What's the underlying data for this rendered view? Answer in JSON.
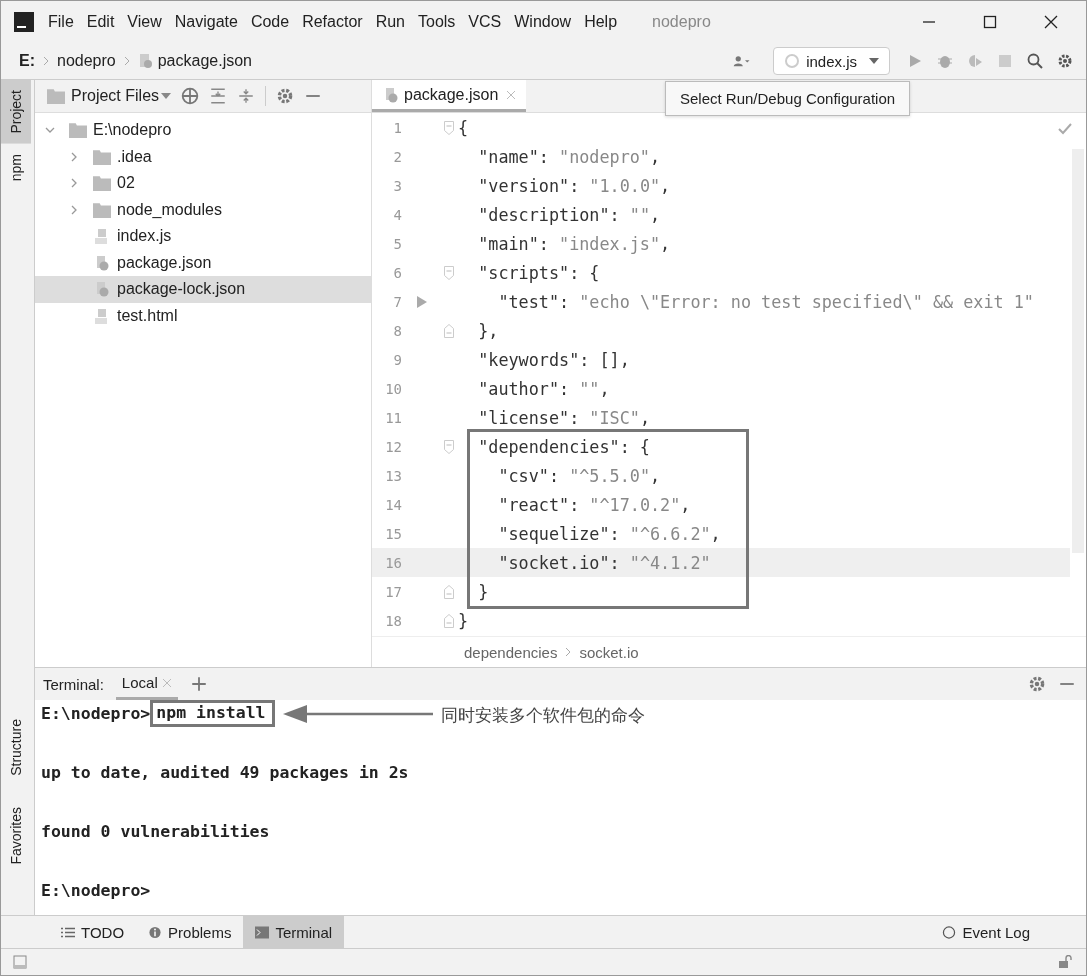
{
  "menu_bar": {
    "items": [
      "File",
      "Edit",
      "View",
      "Navigate",
      "Code",
      "Refactor",
      "Run",
      "Tools",
      "VCS",
      "Window",
      "Help"
    ],
    "title": "nodepro"
  },
  "nav_bar": {
    "breadcrumbs": [
      "E:",
      "nodepro",
      "package.json"
    ],
    "run_config": "index.js",
    "tooltip": "Select Run/Debug Configuration"
  },
  "left_stripe": {
    "top": [
      {
        "label": "Project",
        "selected": true
      },
      {
        "label": "npm",
        "selected": false
      }
    ],
    "bottom": [
      {
        "label": "Structure",
        "selected": false
      },
      {
        "label": "Favorites",
        "selected": false
      }
    ]
  },
  "project": {
    "view": "Project Files",
    "tree": [
      {
        "label": "E:\\nodepro",
        "kind": "folder",
        "expanded": true,
        "selected": false,
        "children": [
          {
            "label": ".idea",
            "kind": "folder",
            "expanded": false,
            "selected": false
          },
          {
            "label": "02",
            "kind": "folder",
            "expanded": false,
            "selected": false
          },
          {
            "label": "node_modules",
            "kind": "folder",
            "expanded": false,
            "selected": false
          },
          {
            "label": "index.js",
            "kind": "js",
            "selected": false
          },
          {
            "label": "package.json",
            "kind": "json",
            "selected": false
          },
          {
            "label": "package-lock.json",
            "kind": "json",
            "selected": true
          },
          {
            "label": "test.html",
            "kind": "html",
            "selected": false
          }
        ]
      }
    ]
  },
  "editor": {
    "tabs": [
      {
        "label": "package.json",
        "selected": true
      }
    ],
    "lines": [
      {
        "no": "1",
        "current": false,
        "kind": "fold-open",
        "segments": [
          {
            "kind": "punct",
            "text": "{"
          }
        ]
      },
      {
        "no": "2",
        "current": false,
        "kind": "plain",
        "segments": [
          {
            "kind": "key",
            "text": "  \"name\""
          },
          {
            "kind": "punct",
            "text": ": "
          },
          {
            "kind": "str",
            "text": "\"nodepro\""
          },
          {
            "kind": "punct",
            "text": ","
          }
        ]
      },
      {
        "no": "3",
        "current": false,
        "kind": "plain",
        "segments": [
          {
            "kind": "key",
            "text": "  \"version\""
          },
          {
            "kind": "punct",
            "text": ": "
          },
          {
            "kind": "str",
            "text": "\"1.0.0\""
          },
          {
            "kind": "punct",
            "text": ","
          }
        ]
      },
      {
        "no": "4",
        "current": false,
        "kind": "plain",
        "segments": [
          {
            "kind": "key",
            "text": "  \"description\""
          },
          {
            "kind": "punct",
            "text": ": "
          },
          {
            "kind": "str",
            "text": "\"\""
          },
          {
            "kind": "punct",
            "text": ","
          }
        ]
      },
      {
        "no": "5",
        "current": false,
        "kind": "plain",
        "segments": [
          {
            "kind": "key",
            "text": "  \"main\""
          },
          {
            "kind": "punct",
            "text": ": "
          },
          {
            "kind": "str",
            "text": "\"index.js\""
          },
          {
            "kind": "punct",
            "text": ","
          }
        ]
      },
      {
        "no": "6",
        "current": false,
        "kind": "fold-open",
        "segments": [
          {
            "kind": "key",
            "text": "  \"scripts\""
          },
          {
            "kind": "punct",
            "text": ": {"
          }
        ]
      },
      {
        "no": "7",
        "current": false,
        "kind": "run",
        "segments": [
          {
            "kind": "key",
            "text": "    \"test\""
          },
          {
            "kind": "punct",
            "text": ": "
          },
          {
            "kind": "str",
            "text": "\"echo \\\"Error: no test specified\\\" && exit 1\""
          }
        ]
      },
      {
        "no": "8",
        "current": false,
        "kind": "fold-close",
        "segments": [
          {
            "kind": "punct",
            "text": "  },"
          }
        ]
      },
      {
        "no": "9",
        "current": false,
        "kind": "plain",
        "segments": [
          {
            "kind": "key",
            "text": "  \"keywords\""
          },
          {
            "kind": "punct",
            "text": ": [],"
          }
        ]
      },
      {
        "no": "10",
        "current": false,
        "kind": "plain",
        "segments": [
          {
            "kind": "key",
            "text": "  \"author\""
          },
          {
            "kind": "punct",
            "text": ": "
          },
          {
            "kind": "str",
            "text": "\"\""
          },
          {
            "kind": "punct",
            "text": ","
          }
        ]
      },
      {
        "no": "11",
        "current": false,
        "kind": "plain",
        "segments": [
          {
            "kind": "key",
            "text": "  \"license\""
          },
          {
            "kind": "punct",
            "text": ": "
          },
          {
            "kind": "str",
            "text": "\"ISC\""
          },
          {
            "kind": "punct",
            "text": ","
          }
        ]
      },
      {
        "no": "12",
        "current": false,
        "kind": "fold-open",
        "segments": [
          {
            "kind": "key",
            "text": "  \"dependencies\""
          },
          {
            "kind": "punct",
            "text": ": {"
          }
        ]
      },
      {
        "no": "13",
        "current": false,
        "kind": "plain",
        "segments": [
          {
            "kind": "key",
            "text": "    \"csv\""
          },
          {
            "kind": "punct",
            "text": ": "
          },
          {
            "kind": "str",
            "text": "\"^5.5.0\""
          },
          {
            "kind": "punct",
            "text": ","
          }
        ]
      },
      {
        "no": "14",
        "current": false,
        "kind": "plain",
        "segments": [
          {
            "kind": "key",
            "text": "    \"react\""
          },
          {
            "kind": "punct",
            "text": ": "
          },
          {
            "kind": "str",
            "text": "\"^17.0.2\""
          },
          {
            "kind": "punct",
            "text": ","
          }
        ]
      },
      {
        "no": "15",
        "current": false,
        "kind": "plain",
        "segments": [
          {
            "kind": "key",
            "text": "    \"sequelize\""
          },
          {
            "kind": "punct",
            "text": ": "
          },
          {
            "kind": "str",
            "text": "\"^6.6.2\""
          },
          {
            "kind": "punct",
            "text": ","
          }
        ]
      },
      {
        "no": "16",
        "current": true,
        "kind": "plain",
        "segments": [
          {
            "kind": "key",
            "text": "    \"socket.io\""
          },
          {
            "kind": "punct",
            "text": ": "
          },
          {
            "kind": "str",
            "text": "\"^4.1.2\""
          }
        ]
      },
      {
        "no": "17",
        "current": false,
        "kind": "fold-close",
        "segments": [
          {
            "kind": "punct",
            "text": "  }"
          }
        ]
      },
      {
        "no": "18",
        "current": false,
        "kind": "fold-close",
        "segments": [
          {
            "kind": "punct",
            "text": "}"
          }
        ]
      }
    ],
    "breadcrumbs": [
      "dependencies",
      "socket.io"
    ]
  },
  "terminal": {
    "title": "Terminal:",
    "tabs": [
      {
        "label": "Local",
        "selected": true
      }
    ],
    "lines": [
      {
        "prompt": "E:\\nodepro>",
        "command": "npm install",
        "note": "同时安装多个软件包的命令"
      },
      {
        "text": "up to date, audited 49 packages in 2s"
      },
      {
        "text": "found 0 vulnerabilities"
      },
      {
        "prompt": "E:\\nodepro>"
      }
    ]
  },
  "bottom_tabs": [
    {
      "label": "TODO",
      "kind": "list",
      "selected": false
    },
    {
      "label": "Problems",
      "kind": "info",
      "selected": false
    },
    {
      "label": "Terminal",
      "kind": "terminal",
      "selected": true
    }
  ],
  "event_log": "Event Log"
}
